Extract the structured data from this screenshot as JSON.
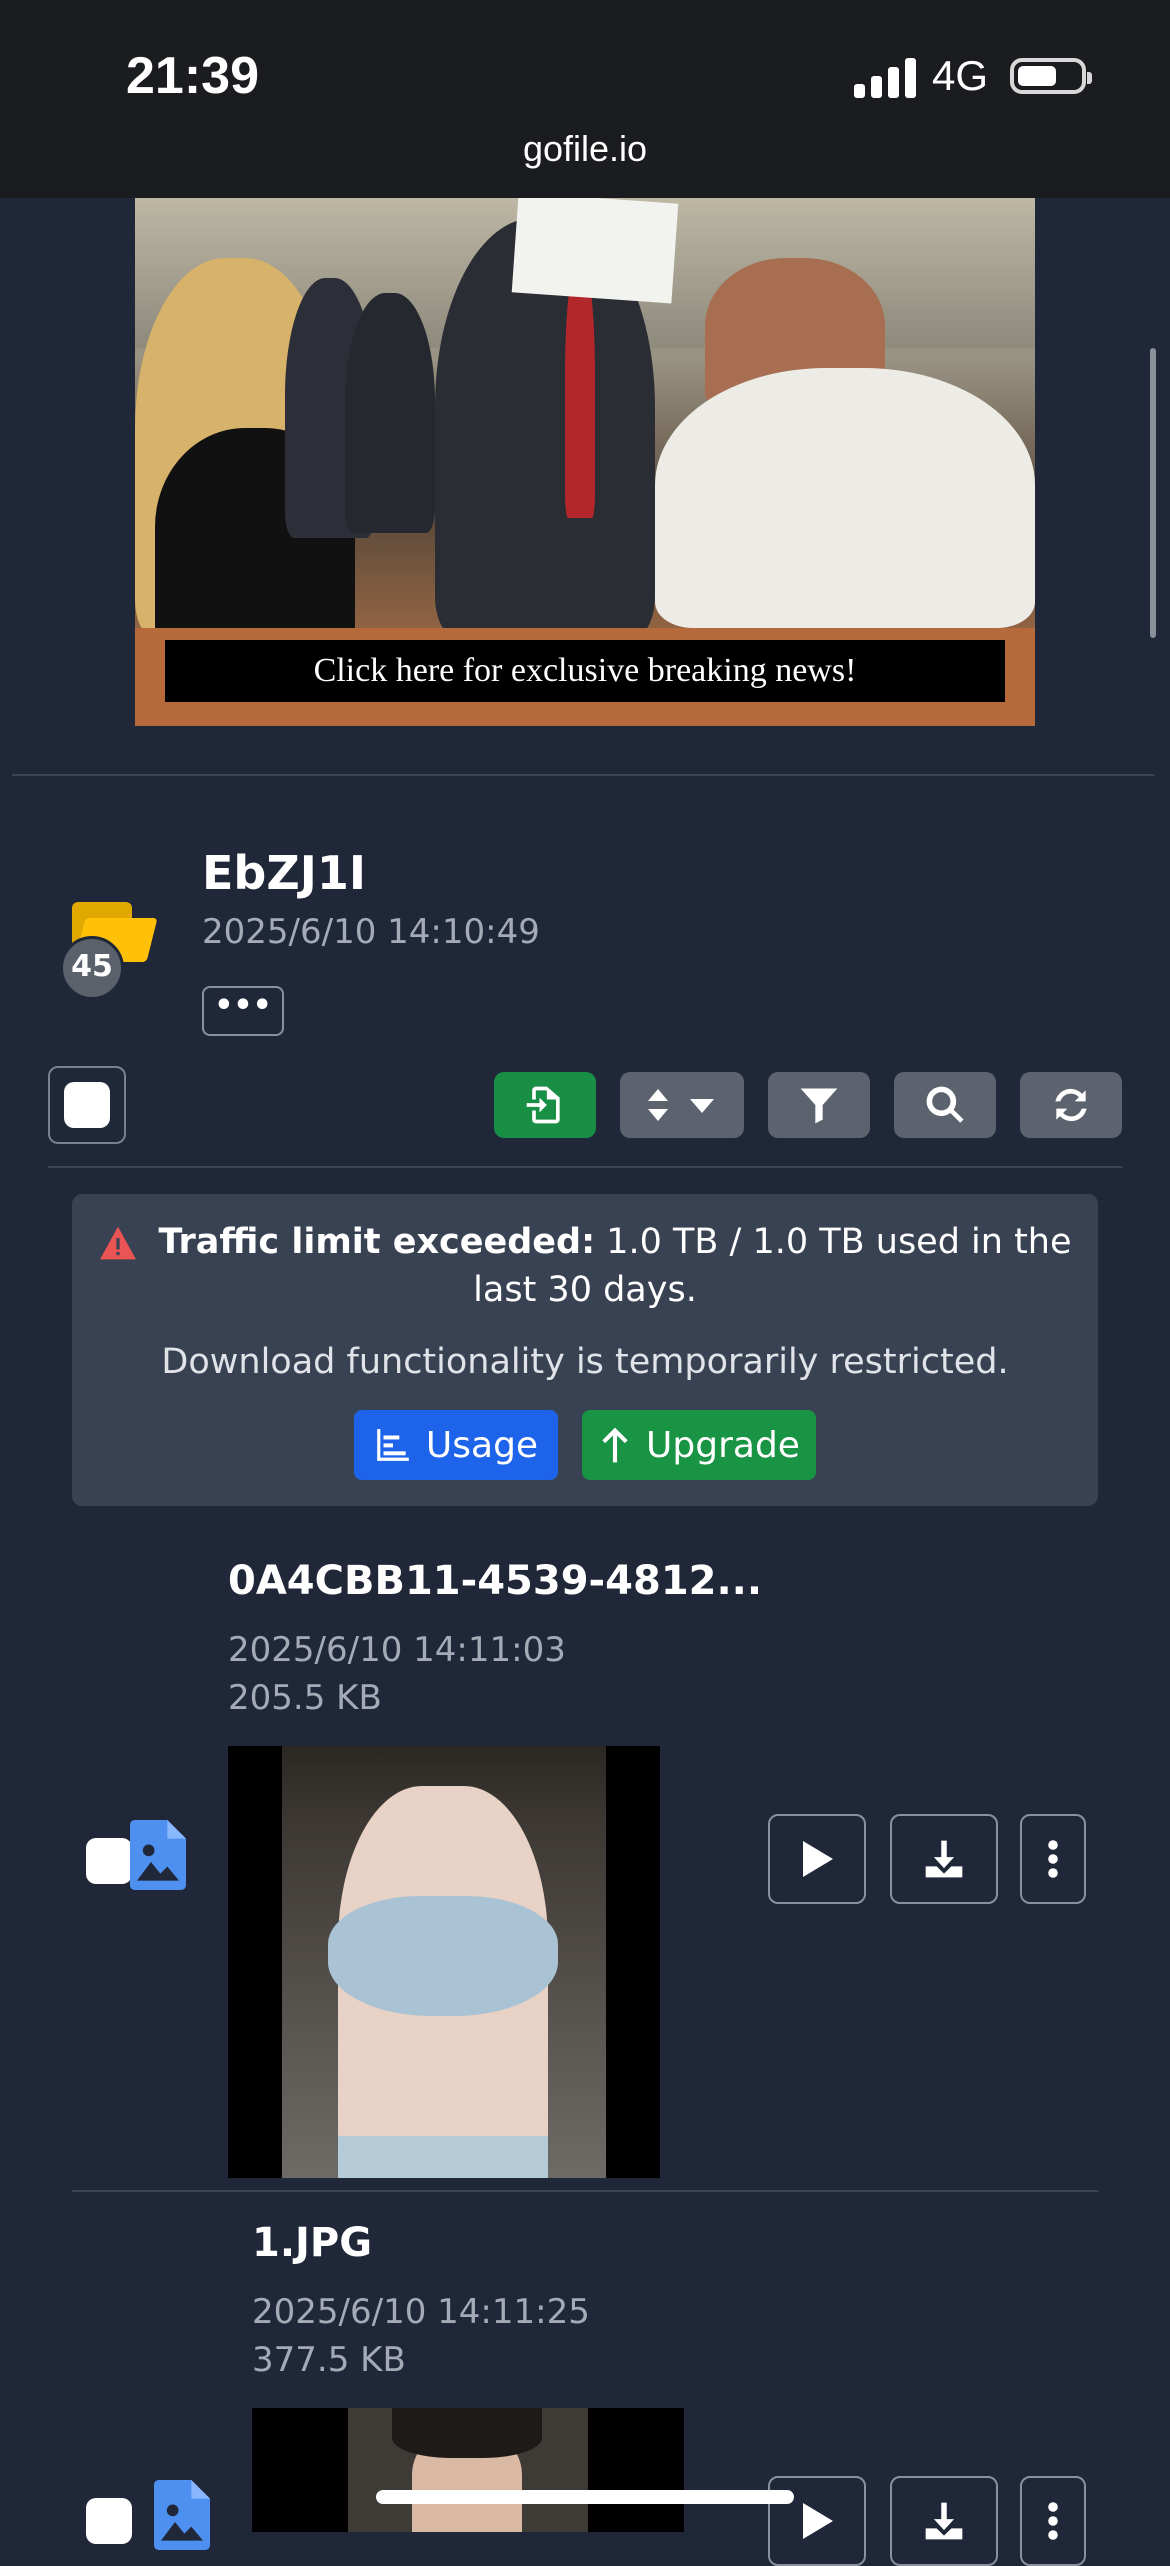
{
  "status_bar": {
    "time": "21:39",
    "network": "4G",
    "url": "gofile.io"
  },
  "ad": {
    "banner_text": "Click here for exclusive breaking news!"
  },
  "folder": {
    "name": "EbZJ1I",
    "date": "2025/6/10 14:10:49",
    "file_count": "45",
    "more_label": "•••"
  },
  "toolbar": {
    "icons": [
      "import-icon",
      "sort-icon",
      "filter-icon",
      "search-icon",
      "refresh-icon"
    ]
  },
  "alert": {
    "title": "Traffic limit exceeded:",
    "message": "1.0 TB / 1.0 TB used in the last 30 days.",
    "restriction": "Download functionality is temporarily restricted.",
    "usage_label": "Usage",
    "upgrade_label": "Upgrade"
  },
  "files": [
    {
      "name": "0A4CBB11-4539-4812...",
      "date": "2025/6/10 14:11:03",
      "size": "205.5 KB"
    },
    {
      "name": "1.JPG",
      "date": "2025/6/10 14:11:25",
      "size": "377.5 KB"
    }
  ]
}
